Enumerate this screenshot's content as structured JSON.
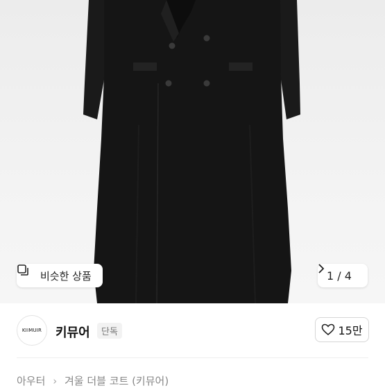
{
  "image": {
    "similar_label": "비슷한 상품",
    "pager": "1 / 4",
    "icons": {
      "similar": "similar-items-icon",
      "next": "chevron-right-icon"
    }
  },
  "shop": {
    "logo_text": "KIIMUIR",
    "name": "키뮤어",
    "badge": "단독",
    "like_count": "15만",
    "like_icon": "heart-outline-icon"
  },
  "breadcrumb": {
    "category": "아우터",
    "subcategory": "겨울 더블 코트 (키뮤어)"
  },
  "colors": {
    "coat": "#151515",
    "image_bg": "#ededed",
    "border": "#d6d6d6"
  }
}
